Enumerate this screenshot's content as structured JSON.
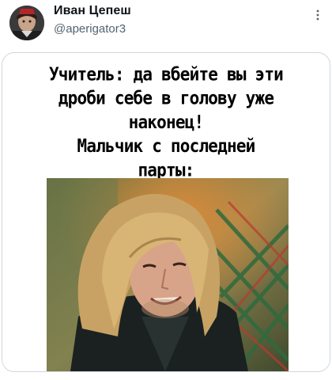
{
  "tweet": {
    "author": {
      "display_name": "Иван Цепеш",
      "handle": "@aperigator3"
    },
    "meme": {
      "caption": "Учитель: да вбейте вы эти\nдроби себе в голову уже\nнаконец!\nМальчик с последней\nпарты:"
    }
  },
  "icons": {
    "more": "more-options-icon"
  },
  "colors": {
    "name": "#0f1419",
    "handle": "#536471",
    "border": "#cfd9de"
  }
}
